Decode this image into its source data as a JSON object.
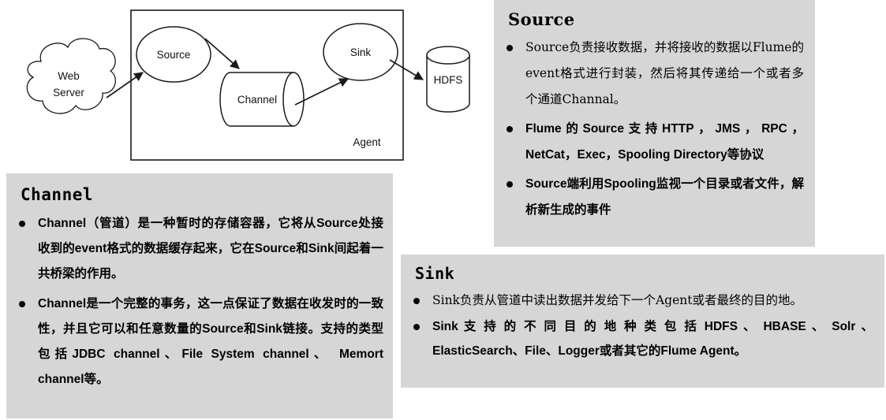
{
  "diagram": {
    "name": "flume-agent-architecture-diagram",
    "nodes": {
      "web_server": "Web\nServer",
      "web_server_line1": "Web",
      "web_server_line2": "Server",
      "source": "Source",
      "channel": "Channel",
      "sink": "Sink",
      "agent": "Agent",
      "hdfs": "HDFS"
    },
    "edges": [
      {
        "from": "Web Server",
        "to": "Source"
      },
      {
        "from": "Source",
        "to": "Channel"
      },
      {
        "from": "Channel",
        "to": "Sink"
      },
      {
        "from": "Sink",
        "to": "HDFS"
      }
    ]
  },
  "colors": {
    "panel_background": "#d6d6d6",
    "text": "#000000",
    "diagram_stroke": "#1a1a1a",
    "page_background": "#ffffff"
  },
  "panels": {
    "channel": {
      "heading": "Channel",
      "bullets": [
        "Channel（管道）是一种暂时的存储容器，它将从Source处接收到的event格式的数据缓存起来，它在Source和Sink间起着一共桥梁的作用。",
        "Channel是一个完整的事务，这一点保证了数据在收发时的一致性，并且它可以和任意数量的Source和Sink链接。支持的类型包括JDBC channel、File System channel、 Memort channel等。"
      ]
    },
    "source": {
      "heading": "Source",
      "bullets": [
        "Source负责接收数据，并将接收的数据以Flume的event格式进行封装，然后将其传递给一个或者多个通道Channal。",
        "Flume的Source支持HTTP，JMS，RPC，NetCat，Exec，Spooling Directory等协议",
        "Source端利用Spooling监视一个目录或者文件，解析新生成的事件"
      ]
    },
    "sink": {
      "heading": "Sink",
      "bullets": [
        "Sink负责从管道中读出数据并发给下一个Agent或者最终的目的地。",
        "Sink 支 持 的 不 同 目 的 地 种 类 包 括 HDFS 、 HBASE 、 Solr 、ElasticSearch、File、Logger或者其它的Flume Agent。"
      ]
    }
  }
}
